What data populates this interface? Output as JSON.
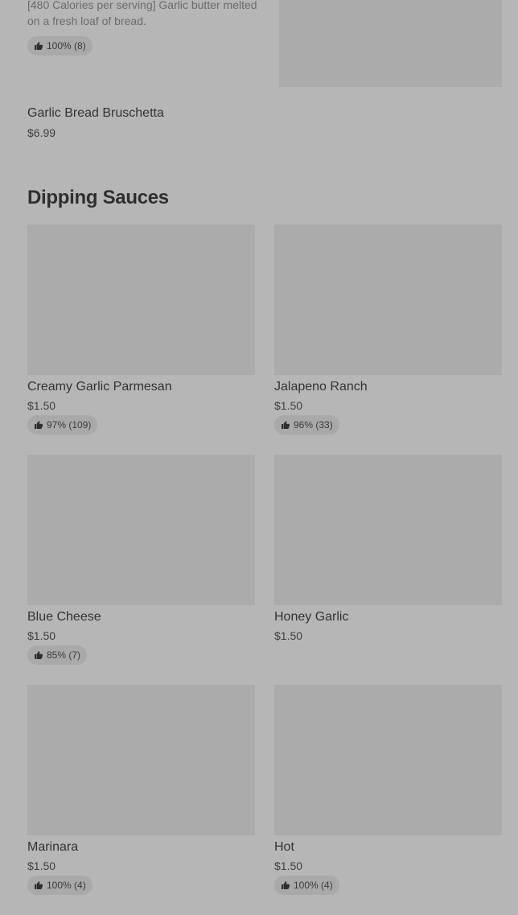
{
  "top_item": {
    "description": "[480 Calories per serving] Garlic butter melted on a fresh loaf of bread.",
    "rating": "100% (8)",
    "title": "Garlic Bread Bruschetta",
    "price": "$6.99"
  },
  "section": {
    "heading": "Dipping Sauces"
  },
  "items": [
    {
      "title": "Creamy Garlic Parmesan",
      "price": "$1.50",
      "rating": "97% (109)"
    },
    {
      "title": "Jalapeno Ranch",
      "price": "$1.50",
      "rating": "96% (33)"
    },
    {
      "title": "Blue Cheese",
      "price": "$1.50",
      "rating": "85% (7)"
    },
    {
      "title": "Honey Garlic",
      "price": "$1.50",
      "rating": ""
    },
    {
      "title": "Marinara",
      "price": "$1.50",
      "rating": "100% (4)"
    },
    {
      "title": "Hot",
      "price": "$1.50",
      "rating": "100% (4)"
    }
  ],
  "icons": {
    "rating_icon": "thumbs-up-icon"
  }
}
